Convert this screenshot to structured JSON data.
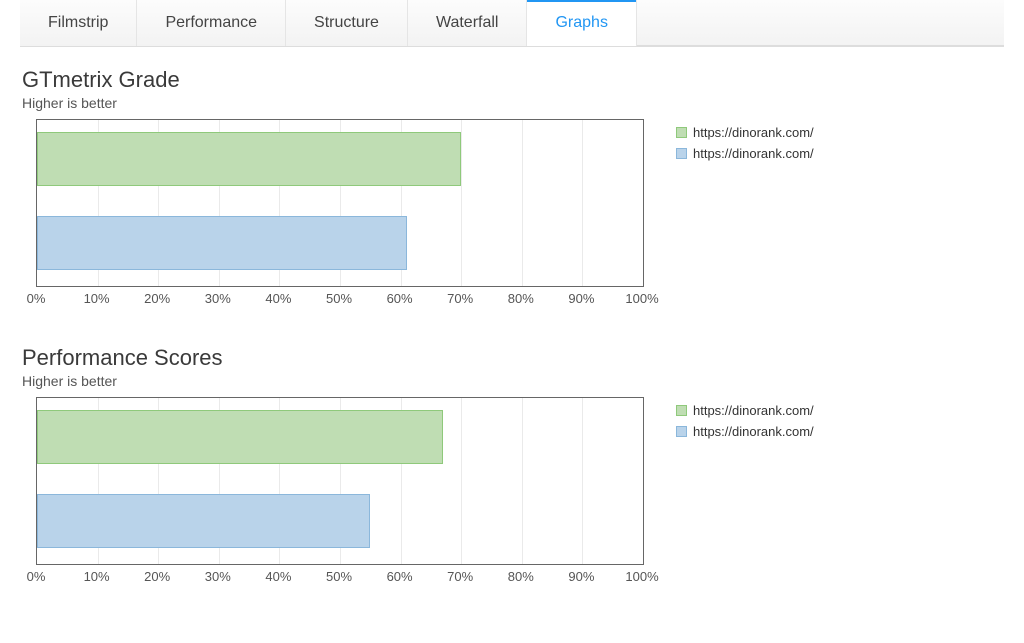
{
  "tabs": {
    "items": [
      {
        "label": "Filmstrip",
        "active": false
      },
      {
        "label": "Performance",
        "active": false
      },
      {
        "label": "Structure",
        "active": false
      },
      {
        "label": "Waterfall",
        "active": false
      },
      {
        "label": "Graphs",
        "active": true
      }
    ]
  },
  "charts": [
    {
      "title": "GTmetrix Grade",
      "subtitle": "Higher is better",
      "legend": [
        {
          "label": "https://dinorank.com/",
          "color": "green"
        },
        {
          "label": "https://dinorank.com/",
          "color": "blue"
        }
      ]
    },
    {
      "title": "Performance Scores",
      "subtitle": "Higher is better",
      "legend": [
        {
          "label": "https://dinorank.com/",
          "color": "green"
        },
        {
          "label": "https://dinorank.com/",
          "color": "blue"
        }
      ]
    }
  ],
  "xticks": [
    "0%",
    "10%",
    "20%",
    "30%",
    "40%",
    "50%",
    "60%",
    "70%",
    "80%",
    "90%",
    "100%"
  ],
  "chart_data": [
    {
      "type": "bar",
      "orientation": "horizontal",
      "title": "GTmetrix Grade",
      "subtitle": "Higher is better",
      "xlabel": "",
      "ylabel": "",
      "xlim": [
        0,
        100
      ],
      "categories": [
        "https://dinorank.com/",
        "https://dinorank.com/"
      ],
      "series": [
        {
          "name": "https://dinorank.com/",
          "color": "#BFDDB3",
          "values": [
            70
          ]
        },
        {
          "name": "https://dinorank.com/",
          "color": "#B9D3EA",
          "values": [
            61
          ]
        }
      ],
      "xticks": [
        "0%",
        "10%",
        "20%",
        "30%",
        "40%",
        "50%",
        "60%",
        "70%",
        "80%",
        "90%",
        "100%"
      ]
    },
    {
      "type": "bar",
      "orientation": "horizontal",
      "title": "Performance Scores",
      "subtitle": "Higher is better",
      "xlabel": "",
      "ylabel": "",
      "xlim": [
        0,
        100
      ],
      "categories": [
        "https://dinorank.com/",
        "https://dinorank.com/"
      ],
      "series": [
        {
          "name": "https://dinorank.com/",
          "color": "#BFDDB3",
          "values": [
            67
          ]
        },
        {
          "name": "https://dinorank.com/",
          "color": "#B9D3EA",
          "values": [
            55
          ]
        }
      ],
      "xticks": [
        "0%",
        "10%",
        "20%",
        "30%",
        "40%",
        "50%",
        "60%",
        "70%",
        "80%",
        "90%",
        "100%"
      ]
    }
  ],
  "colors": {
    "green_fill": "#BFDDB3",
    "green_border": "#8FC97B",
    "blue_fill": "#B9D3EA",
    "blue_border": "#8BB7DB",
    "accent": "#2196F3"
  }
}
